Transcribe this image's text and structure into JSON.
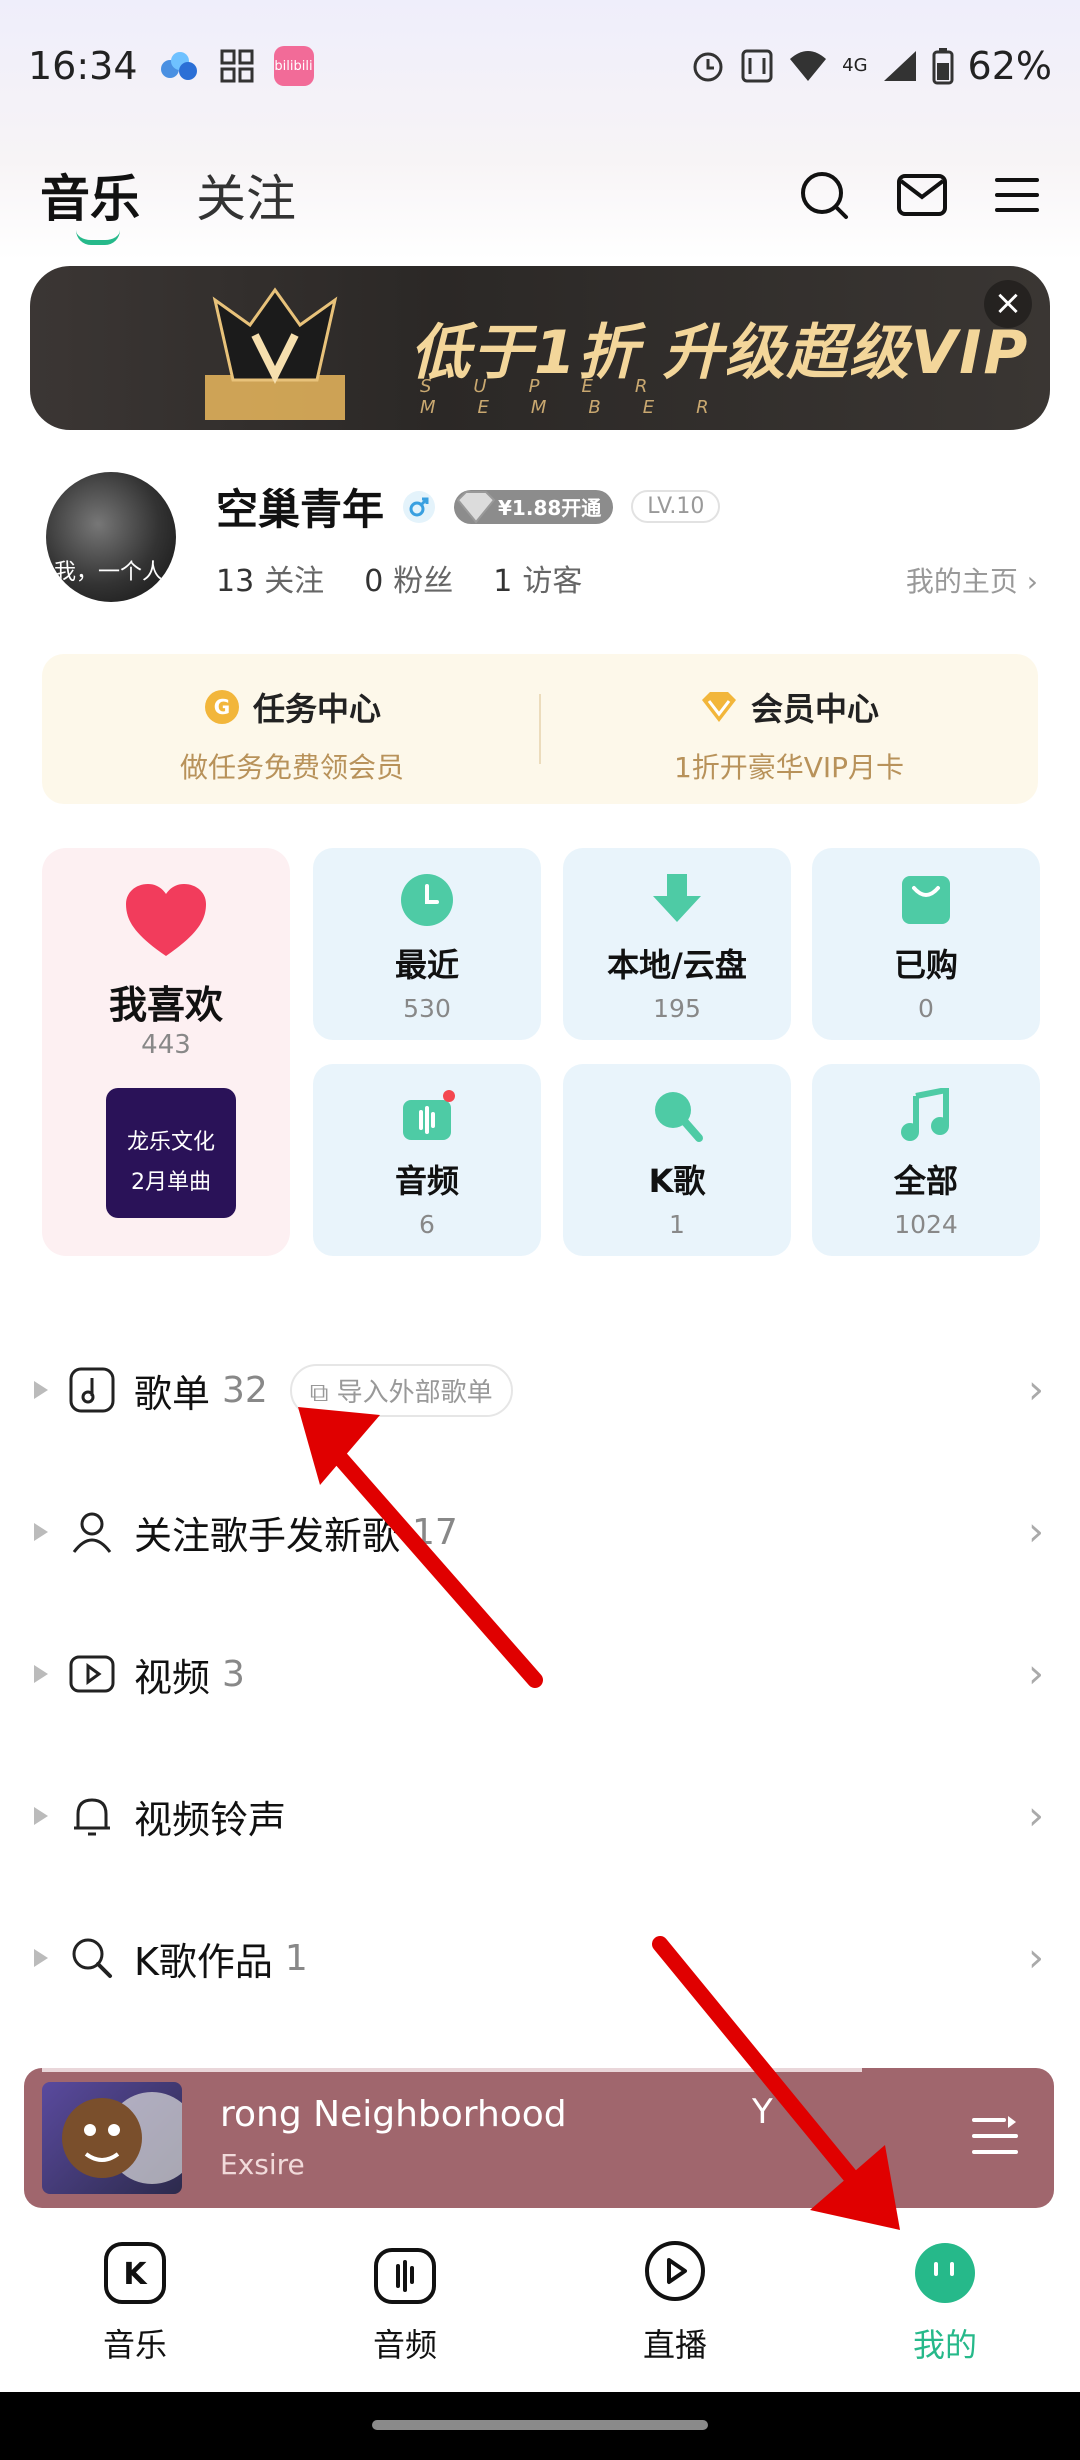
{
  "status_bar": {
    "time": "16:34",
    "app_badge": "bilibili",
    "network": "4G",
    "battery": "62%"
  },
  "header": {
    "tabs": [
      {
        "label": "音乐"
      },
      {
        "label": "关注"
      }
    ]
  },
  "banner": {
    "title": "低于1折 升级超级VIP",
    "subtitle": "SUPER MEMBER"
  },
  "profile": {
    "name": "空巢青年",
    "vip_price": "¥1.88开通",
    "level": "LV.10",
    "avatar_caption": "我，一个人",
    "following_count": "13",
    "following_label": "关注",
    "fans_count": "0",
    "fans_label": "粉丝",
    "visitors_count": "1",
    "visitors_label": "访客",
    "home_link": "我的主页 ›"
  },
  "tasks": [
    {
      "title": "任务中心",
      "subtitle": "做任务免费领会员"
    },
    {
      "title": "会员中心",
      "subtitle": "1折开豪华VIP月卡"
    }
  ],
  "favorites": {
    "title": "我喜欢",
    "count": "443",
    "promo_line1": "龙乐文化",
    "promo_line2": "2月单曲"
  },
  "grid": [
    {
      "name": "最近",
      "count": "530"
    },
    {
      "name": "本地/云盘",
      "count": "195"
    },
    {
      "name": "已购",
      "count": "0"
    },
    {
      "name": "音频",
      "count": "6"
    },
    {
      "name": "K歌",
      "count": "1"
    },
    {
      "name": "全部",
      "count": "1024"
    }
  ],
  "list": [
    {
      "label": "歌单",
      "count": "32",
      "extra": "导入外部歌单"
    },
    {
      "label": "关注歌手发新歌",
      "count": "17"
    },
    {
      "label": "视频",
      "count": "3"
    },
    {
      "label": "视频铃声",
      "count": ""
    },
    {
      "label": "K歌作品",
      "count": "1"
    }
  ],
  "player": {
    "title": "rong Neighborhood",
    "artist": "Exsire",
    "extra": "Y"
  },
  "bottom_nav": [
    {
      "label": "音乐"
    },
    {
      "label": "音频"
    },
    {
      "label": "直播"
    },
    {
      "label": "我的"
    }
  ],
  "colors": {
    "accent": "#26b98a",
    "player_bg": "#a0666d",
    "annotation": "#e00000"
  }
}
